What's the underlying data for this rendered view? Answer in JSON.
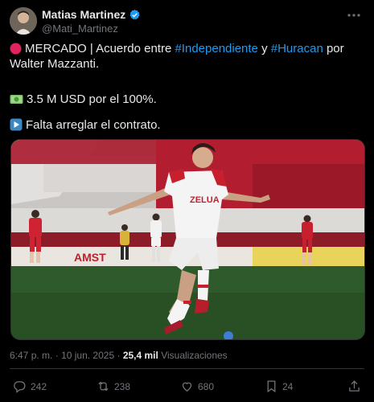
{
  "author": {
    "name": "Matias Martinez",
    "handle": "@Mati_Martinez",
    "verified": true
  },
  "tweet": {
    "line1_prefix": "MERCADO | Acuerdo entre ",
    "line1_link1": "#Independiente",
    "line1_mid": " y ",
    "line1_link2": "#Huracan",
    "line1_suffix": " por Walter Mazzanti.",
    "line2": "3.5 M USD por el 100%.",
    "line3": "Falta arreglar el contrato."
  },
  "media": {
    "jersey_sponsor": "ZELUA",
    "board_text": "AMST"
  },
  "meta": {
    "time": "6:47 p. m.",
    "sep": "·",
    "date": "10 jun. 2025",
    "views_count": "25,4 mil",
    "views_label": "Visualizaciones"
  },
  "actions": {
    "replies": "242",
    "reposts": "238",
    "likes": "680",
    "bookmarks": "24"
  },
  "colors": {
    "link": "#1d9bf0",
    "muted": "#71767b",
    "text": "#e7e9ea",
    "background": "#000000"
  },
  "icons": [
    "more-icon",
    "verified-icon",
    "red-circle-icon",
    "money-icon",
    "play-icon",
    "reply-icon",
    "repost-icon",
    "like-icon",
    "bookmark-icon",
    "share-icon"
  ]
}
